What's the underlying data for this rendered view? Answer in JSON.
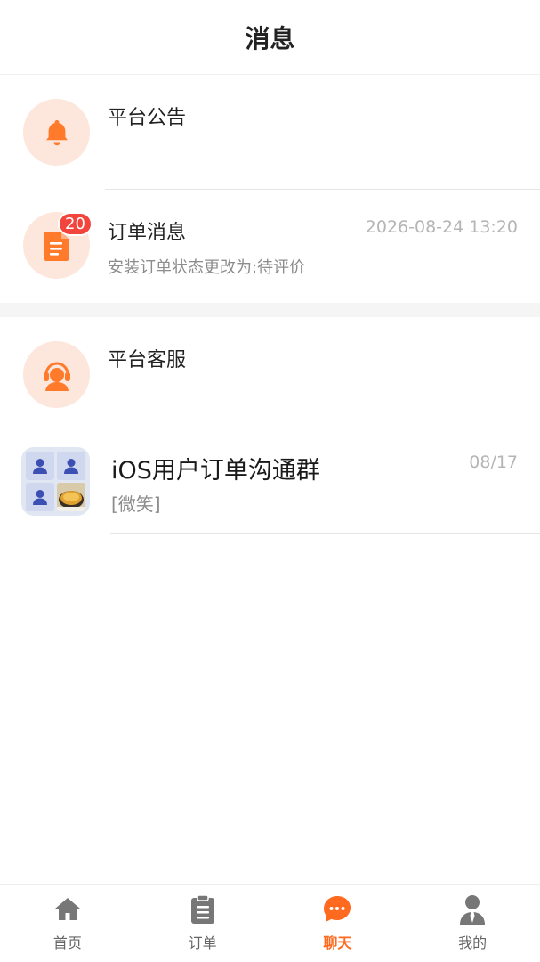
{
  "header": {
    "title": "消息"
  },
  "messages": [
    {
      "title": "平台公告",
      "icon": "bell-icon"
    },
    {
      "title": "订单消息",
      "icon": "document-icon",
      "badge": "20",
      "time": "2026-08-24 13:20",
      "preview": "安装订单状态更改为:待评价"
    },
    {
      "title": "平台客服",
      "icon": "headset-agent-icon"
    },
    {
      "title": "iOS用户订单沟通群",
      "icon": "group-avatar-icon",
      "time": "08/17",
      "preview": "[微笑]"
    }
  ],
  "tabbar": {
    "items": [
      {
        "label": "首页",
        "icon": "home-icon",
        "active": false
      },
      {
        "label": "订单",
        "icon": "clipboard-icon",
        "active": false
      },
      {
        "label": "聊天",
        "icon": "chat-bubble-icon",
        "active": true
      },
      {
        "label": "我的",
        "icon": "user-icon",
        "active": false
      }
    ]
  },
  "colors": {
    "accent": "#ff6a1f",
    "badge": "#f2453d",
    "avatar_bg": "#fde6dc",
    "icon_orange": "#ff7a2b"
  }
}
